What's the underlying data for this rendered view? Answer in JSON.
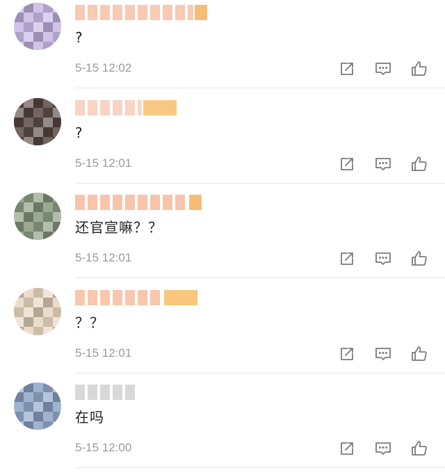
{
  "comments": [
    {
      "text": "?",
      "time": "5-15 12:02",
      "avatar_color": "#c8b8e6",
      "name_color": "#f8c9b3",
      "badge_color": "#f2a748"
    },
    {
      "text": "?",
      "time": "5-15 12:01",
      "avatar_color": "#5a4a45",
      "name_color": "#f9d4c3",
      "badge_color": "#f5b65a"
    },
    {
      "text": "还官宣嘛？？",
      "time": "5-15 12:01",
      "avatar_color": "#8a9a80",
      "name_color": "#f8c4aa",
      "badge_color": "#f2a748"
    },
    {
      "text": "？？",
      "time": "5-15 12:01",
      "avatar_color": "#e8d6c0",
      "name_color": "#f8c7ad",
      "badge_color": "#f5b451"
    },
    {
      "text": "在吗",
      "time": "5-15 12:00",
      "avatar_color": "#8fa6c8",
      "name_color": "#d8d8d8",
      "badge_color": ""
    }
  ],
  "icons": {
    "share": "share-icon",
    "reply": "comment-icon",
    "like": "thumbs-up-icon"
  },
  "colors": {
    "icon": "#7a7a7a",
    "time": "#9a9a9a",
    "divider": "#e6e6e6"
  }
}
